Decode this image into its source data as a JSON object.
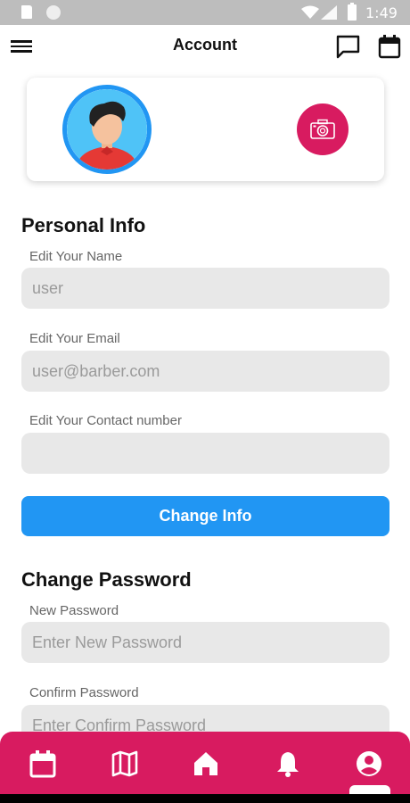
{
  "status_bar": {
    "time": "1:49"
  },
  "app_bar": {
    "title": "Account"
  },
  "personal_info": {
    "title": "Personal Info",
    "name_label": "Edit Your Name",
    "name_value": "user",
    "email_label": "Edit Your Email",
    "email_value": "user@barber.com",
    "contact_label": "Edit Your Contact number",
    "contact_value": "",
    "button_label": "Change Info"
  },
  "change_password": {
    "title": "Change Password",
    "new_label": "New Password",
    "new_placeholder": "Enter New Password",
    "confirm_label": "Confirm Password",
    "confirm_placeholder": "Enter Confirm Password"
  },
  "bottom_nav": {
    "items": [
      "calendar-icon",
      "map-icon",
      "home-icon",
      "bell-icon",
      "account-icon"
    ],
    "active": "account-icon"
  },
  "colors": {
    "primary": "#2196f3",
    "accent": "#d81b60",
    "field_bg": "#e8e8e8"
  }
}
